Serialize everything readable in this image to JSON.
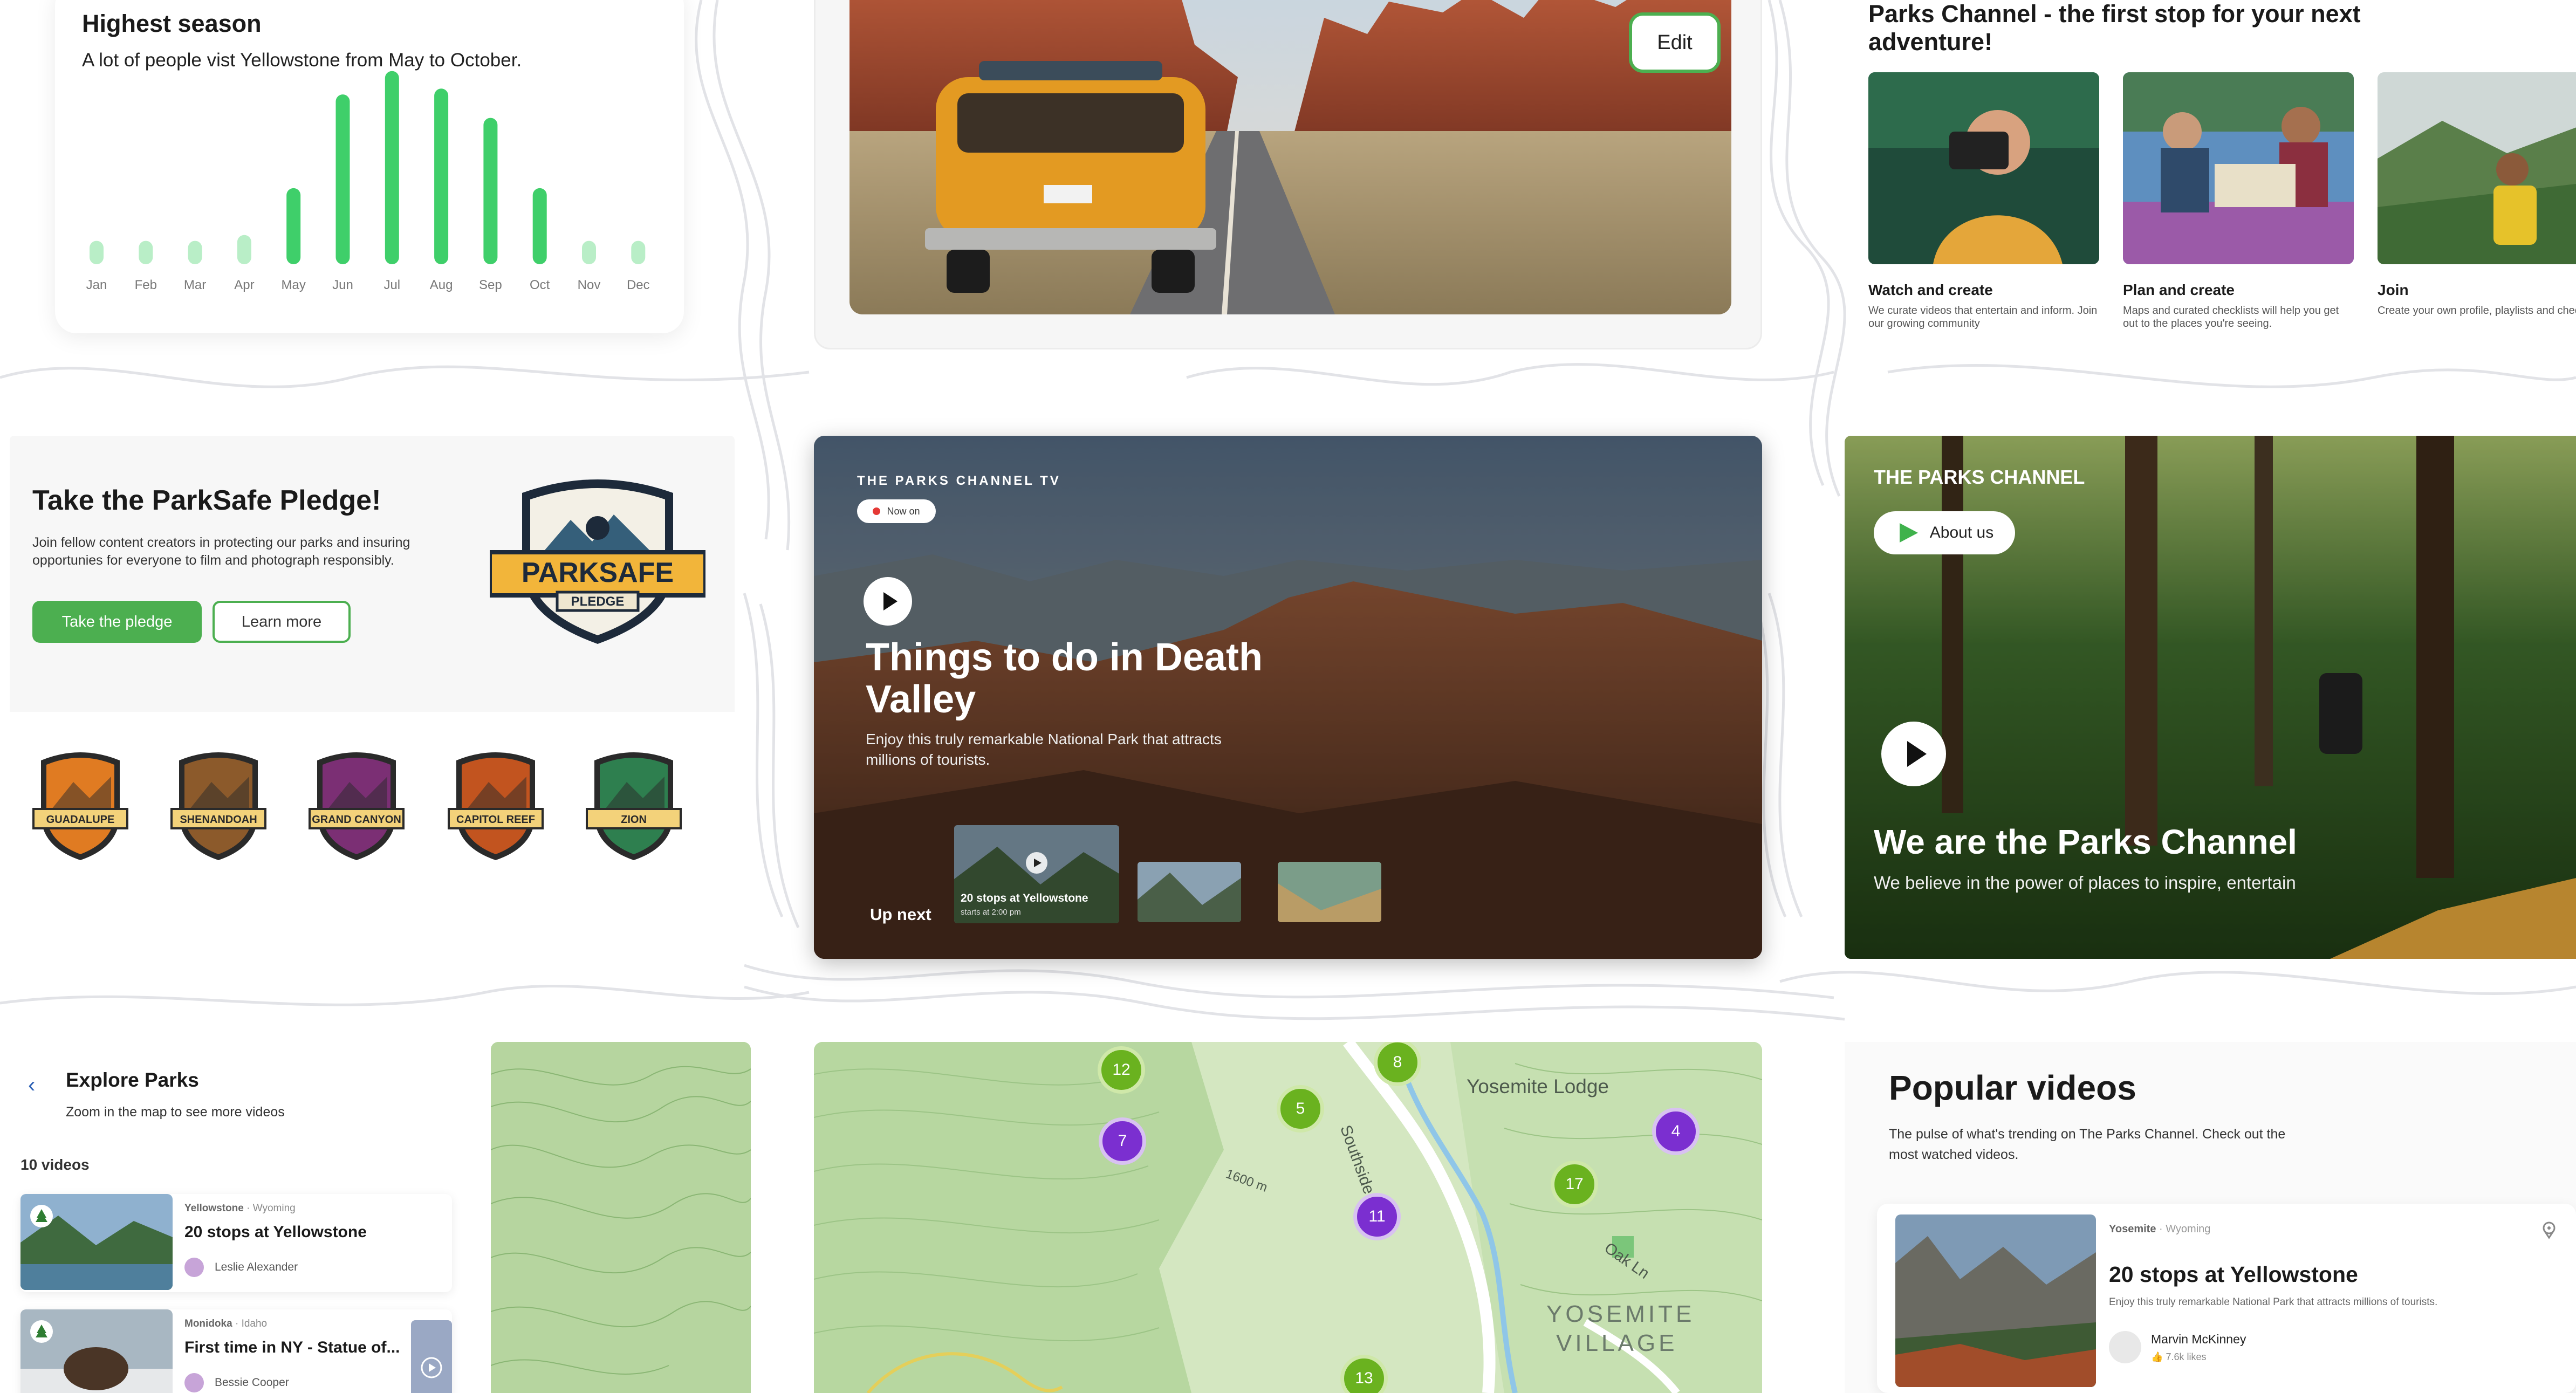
{
  "chart_card": {
    "title": "Highest season",
    "subtitle": "A lot of people vist Yellowstone from May to October."
  },
  "chart_data": {
    "type": "bar",
    "categories": [
      "Jan",
      "Feb",
      "Mar",
      "Apr",
      "May",
      "Jun",
      "Jul",
      "Aug",
      "Sep",
      "Oct",
      "Nov",
      "Dec"
    ],
    "values": [
      4,
      4,
      4,
      5,
      13,
      29,
      33,
      30,
      25,
      13,
      4,
      4
    ],
    "highlight": [
      false,
      false,
      false,
      false,
      true,
      true,
      true,
      true,
      true,
      true,
      false,
      false
    ],
    "colors": {
      "high": "#3fcf6a",
      "low": "#b9eec7"
    },
    "title": "Highest season",
    "xlabel": "",
    "ylabel": "",
    "ylim": [
      0,
      35
    ],
    "grid": false
  },
  "edit_card": {
    "edit_label": "Edit"
  },
  "intro": {
    "headline": "Parks Channel - the first stop for your next adventure!",
    "items": [
      {
        "label": "Watch and create",
        "desc": "We curate videos that entertain and inform. Join our growing community"
      },
      {
        "label": "Plan and create",
        "desc": "Maps and curated checklists will help you get out to the places you're seeing."
      },
      {
        "label": "Join",
        "desc": "Create your own profile, playlists and checklists."
      }
    ]
  },
  "pledge": {
    "title": "Take the ParkSafe Pledge!",
    "desc": "Join fellow content creators in protecting our parks and insuring opportunies for everyone to film and photograph responsibly.",
    "primary_label": "Take the pledge",
    "secondary_label": "Learn more",
    "badge_text": "PARKSAFE",
    "badge_sub": "PLEDGE",
    "park_badges": [
      "GUADALUPE",
      "SHENANDOAH",
      "GRAND CANYON",
      "CAPITOL REEF",
      "ZION"
    ],
    "badge_colors": [
      "#e07b22",
      "#8c5a2b",
      "#7b2f74",
      "#c2541f",
      "#2e7f4f"
    ],
    "brand_color": "#4caf50"
  },
  "hero": {
    "kicker": "THE PARKS CHANNEL TV",
    "now_on": "Now on",
    "title": "Things to do in Death Valley",
    "desc": "Enjoy this truly remarkable National Park that attracts millions of tourists.",
    "up_next": "Up next",
    "thumb_caption": "20 stops at Yellowstone",
    "thumb_time": "starts at 2:00 pm"
  },
  "about": {
    "kicker": "THE PARKS CHANNEL",
    "button_label": "About us",
    "title": "We are the Parks Channel",
    "desc": "We believe in the power of places to inspire, entertain"
  },
  "explore": {
    "title": "Explore Parks",
    "subtitle": "Zoom in the map to see more videos",
    "count": "10 videos",
    "items": [
      {
        "park": "Yellowstone",
        "state": "Wyoming",
        "title": "20 stops at Yellowstone",
        "author": "Leslie Alexander"
      },
      {
        "park": "Monidoka",
        "state": "Idaho",
        "title": "First time in NY - Statue of...",
        "author": "Bessie Cooper"
      }
    ]
  },
  "map": {
    "clusters": [
      "12",
      "8",
      "5",
      "7",
      "11",
      "17",
      "4",
      "13"
    ],
    "labels": {
      "lodge": "Yosemite Lodge",
      "road": "Southside Dr",
      "lane": "Oak Ln",
      "village1": "YOSEMITE",
      "village2": "VILLAGE",
      "elev": "1600 m"
    }
  },
  "popular": {
    "title": "Popular videos",
    "subtitle": "The pulse of what's trending on The Parks Channel. Check out the most watched videos.",
    "item": {
      "park": "Yosemite",
      "state": "Wyoming",
      "title": "20 stops at Yellowstone",
      "desc": "Enjoy this truly remarkable National Park that attracts millions of tourists.",
      "author": "Marvin McKinney",
      "likes": "7.6k likes"
    }
  }
}
